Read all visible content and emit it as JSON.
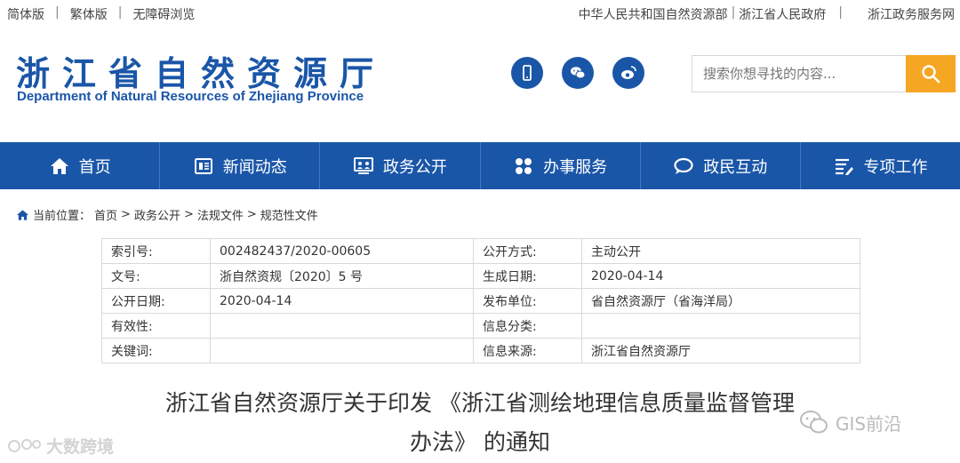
{
  "topbar": {
    "left_links": [
      "简体版",
      "繁体版",
      "无障碍浏览"
    ],
    "right_links": [
      "中华人民共和国自然资源部",
      "浙江省人民政府",
      "浙江政务服务网"
    ]
  },
  "header": {
    "logo_cn": "浙江省自然资源厅",
    "logo_en": "Department of Natural Resources of Zhejiang Province",
    "social_icons": [
      "mobile-icon",
      "wechat-icon",
      "weibo-icon"
    ],
    "search_placeholder": "搜索你想寻找的内容..."
  },
  "nav": {
    "items": [
      {
        "label": "首页",
        "icon": "home-icon"
      },
      {
        "label": "新闻动态",
        "icon": "news-icon"
      },
      {
        "label": "政务公开",
        "icon": "government-icon"
      },
      {
        "label": "办事服务",
        "icon": "services-icon"
      },
      {
        "label": "政民互动",
        "icon": "chat-icon"
      },
      {
        "label": "专项工作",
        "icon": "list-icon"
      }
    ]
  },
  "breadcrumb": {
    "prefix": "当前位置：",
    "path": [
      "首页",
      "政务公开",
      "法规文件",
      "规范性文件"
    ],
    "separator": ">"
  },
  "info_table": {
    "rows": [
      {
        "k1": "索引号:",
        "v1": "002482437/2020-00605",
        "k2": "公开方式:",
        "v2": "主动公开"
      },
      {
        "k1": "文号:",
        "v1": "浙自然资规〔2020〕5 号",
        "k2": "生成日期:",
        "v2": "2020-04-14"
      },
      {
        "k1": "公开日期:",
        "v1": "2020-04-14",
        "k2": "发布单位:",
        "v2": "省自然资源厅（省海洋局）"
      },
      {
        "k1": "有效性:",
        "v1": "",
        "k2": "信息分类:",
        "v2": ""
      },
      {
        "k1": "关键词:",
        "v1": "",
        "k2": "信息来源:",
        "v2": "浙江省自然资源厅"
      }
    ]
  },
  "document": {
    "title_line1": "浙江省自然资源厅关于印发 《浙江省测绘地理信息质量监督管理",
    "title_line2": "办法》 的通知"
  },
  "watermarks": {
    "left": "大数跨境",
    "right": "GIS前沿"
  },
  "colors": {
    "brand_blue": "#1a56a8",
    "search_button": "#f5a623"
  }
}
